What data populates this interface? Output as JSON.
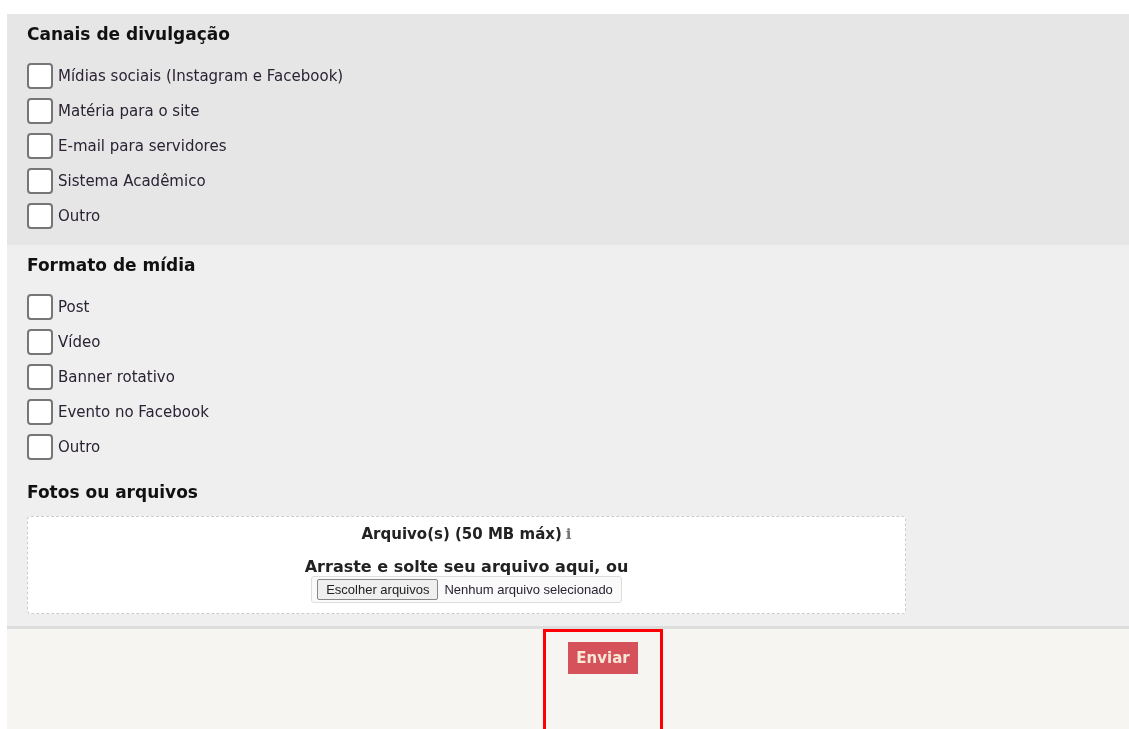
{
  "sections": [
    {
      "title": "Canais de divulgação",
      "color": "#e6e6e6",
      "options": [
        {
          "label": "Mídias sociais (Instagram e Facebook)",
          "checked": false
        },
        {
          "label": "Matéria para o site",
          "checked": false
        },
        {
          "label": "E-mail para servidores",
          "checked": false
        },
        {
          "label": "Sistema Acadêmico",
          "checked": false
        },
        {
          "label": "Outro",
          "checked": false
        }
      ]
    },
    {
      "title": "Formato de mídia",
      "color": "#efefef",
      "options": [
        {
          "label": "Post",
          "checked": false
        },
        {
          "label": "Vídeo",
          "checked": false
        },
        {
          "label": "Banner rotativo",
          "checked": false
        },
        {
          "label": "Evento no Facebook",
          "checked": false
        },
        {
          "label": "Outro",
          "checked": false
        }
      ]
    }
  ],
  "upload": {
    "title": "Fotos ou arquivos",
    "limit": "Arquivo(s) (50 MB máx)",
    "info": "i",
    "drop_hint": "Arraste e solte seu arquivo aqui, ou",
    "choose_button": "Escolher arquivos",
    "status": "Nenhum arquivo selecionado"
  },
  "submit": {
    "label": "Enviar",
    "highlighted": true
  }
}
